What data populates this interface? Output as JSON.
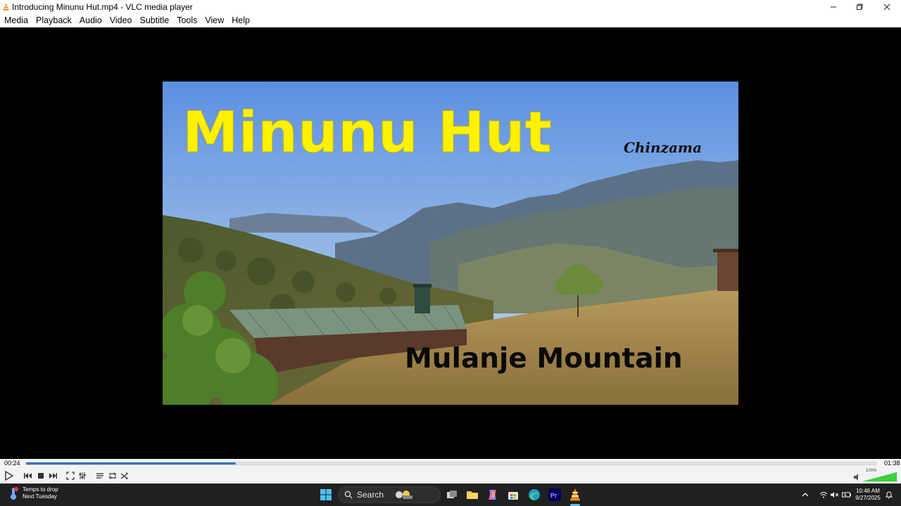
{
  "window": {
    "title": "Introducing Minunu Hut.mp4 - VLC media player",
    "app_icon": "vlc-cone-icon",
    "controls": [
      "minimize-icon",
      "maximize-icon",
      "close-icon"
    ]
  },
  "menu": {
    "items": [
      "Media",
      "Playback",
      "Audio",
      "Video",
      "Subtitle",
      "Tools",
      "View",
      "Help"
    ]
  },
  "video": {
    "title_text": "Minunu Hut",
    "subtitle_text": "Chinzama",
    "caption_text": "Mulanje Mountain",
    "title_color": "#fff200",
    "scene": "mountain hut with green corrugated roof on grassy hillside under blue sky"
  },
  "player": {
    "elapsed": "00:24",
    "total": "01:38",
    "progress_fraction": 0.247,
    "accent": "#3078c6",
    "volume_label": "100%",
    "volume_fraction": 1.0,
    "buttons": [
      "play-icon",
      "previous-icon",
      "stop-icon",
      "next-icon",
      "fullscreen-icon",
      "extended-settings-icon",
      "playlist-icon",
      "loop-icon",
      "shuffle-icon"
    ]
  },
  "taskbar": {
    "weather_line1": "Temps to drop",
    "weather_line2": "Next Tuesday",
    "search_label": "Search",
    "pinned": [
      "windows-start-icon",
      "search-icon",
      "task-view-icon",
      "file-explorer-icon",
      "copilot-icon",
      "microsoft-store-icon",
      "edge-icon",
      "premiere-pro-icon",
      "vlc-icon"
    ],
    "premiere_label": "Pr",
    "clock_time": "10:46 AM",
    "clock_date": "9/27/2025"
  }
}
